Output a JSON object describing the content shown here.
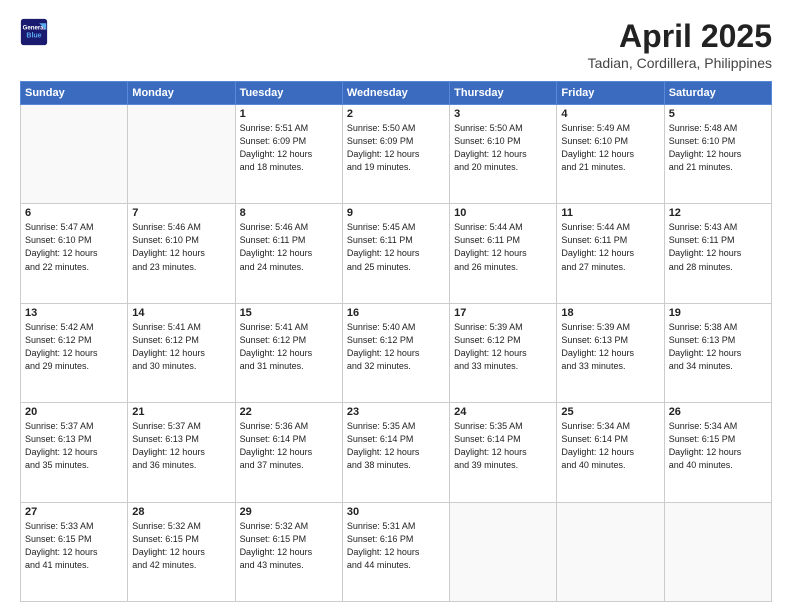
{
  "logo": {
    "line1": "General",
    "line2": "Blue"
  },
  "title": "April 2025",
  "subtitle": "Tadian, Cordillera, Philippines",
  "weekdays": [
    "Sunday",
    "Monday",
    "Tuesday",
    "Wednesday",
    "Thursday",
    "Friday",
    "Saturday"
  ],
  "weeks": [
    [
      {
        "day": "",
        "info": ""
      },
      {
        "day": "",
        "info": ""
      },
      {
        "day": "1",
        "info": "Sunrise: 5:51 AM\nSunset: 6:09 PM\nDaylight: 12 hours\nand 18 minutes."
      },
      {
        "day": "2",
        "info": "Sunrise: 5:50 AM\nSunset: 6:09 PM\nDaylight: 12 hours\nand 19 minutes."
      },
      {
        "day": "3",
        "info": "Sunrise: 5:50 AM\nSunset: 6:10 PM\nDaylight: 12 hours\nand 20 minutes."
      },
      {
        "day": "4",
        "info": "Sunrise: 5:49 AM\nSunset: 6:10 PM\nDaylight: 12 hours\nand 21 minutes."
      },
      {
        "day": "5",
        "info": "Sunrise: 5:48 AM\nSunset: 6:10 PM\nDaylight: 12 hours\nand 21 minutes."
      }
    ],
    [
      {
        "day": "6",
        "info": "Sunrise: 5:47 AM\nSunset: 6:10 PM\nDaylight: 12 hours\nand 22 minutes."
      },
      {
        "day": "7",
        "info": "Sunrise: 5:46 AM\nSunset: 6:10 PM\nDaylight: 12 hours\nand 23 minutes."
      },
      {
        "day": "8",
        "info": "Sunrise: 5:46 AM\nSunset: 6:11 PM\nDaylight: 12 hours\nand 24 minutes."
      },
      {
        "day": "9",
        "info": "Sunrise: 5:45 AM\nSunset: 6:11 PM\nDaylight: 12 hours\nand 25 minutes."
      },
      {
        "day": "10",
        "info": "Sunrise: 5:44 AM\nSunset: 6:11 PM\nDaylight: 12 hours\nand 26 minutes."
      },
      {
        "day": "11",
        "info": "Sunrise: 5:44 AM\nSunset: 6:11 PM\nDaylight: 12 hours\nand 27 minutes."
      },
      {
        "day": "12",
        "info": "Sunrise: 5:43 AM\nSunset: 6:11 PM\nDaylight: 12 hours\nand 28 minutes."
      }
    ],
    [
      {
        "day": "13",
        "info": "Sunrise: 5:42 AM\nSunset: 6:12 PM\nDaylight: 12 hours\nand 29 minutes."
      },
      {
        "day": "14",
        "info": "Sunrise: 5:41 AM\nSunset: 6:12 PM\nDaylight: 12 hours\nand 30 minutes."
      },
      {
        "day": "15",
        "info": "Sunrise: 5:41 AM\nSunset: 6:12 PM\nDaylight: 12 hours\nand 31 minutes."
      },
      {
        "day": "16",
        "info": "Sunrise: 5:40 AM\nSunset: 6:12 PM\nDaylight: 12 hours\nand 32 minutes."
      },
      {
        "day": "17",
        "info": "Sunrise: 5:39 AM\nSunset: 6:12 PM\nDaylight: 12 hours\nand 33 minutes."
      },
      {
        "day": "18",
        "info": "Sunrise: 5:39 AM\nSunset: 6:13 PM\nDaylight: 12 hours\nand 33 minutes."
      },
      {
        "day": "19",
        "info": "Sunrise: 5:38 AM\nSunset: 6:13 PM\nDaylight: 12 hours\nand 34 minutes."
      }
    ],
    [
      {
        "day": "20",
        "info": "Sunrise: 5:37 AM\nSunset: 6:13 PM\nDaylight: 12 hours\nand 35 minutes."
      },
      {
        "day": "21",
        "info": "Sunrise: 5:37 AM\nSunset: 6:13 PM\nDaylight: 12 hours\nand 36 minutes."
      },
      {
        "day": "22",
        "info": "Sunrise: 5:36 AM\nSunset: 6:14 PM\nDaylight: 12 hours\nand 37 minutes."
      },
      {
        "day": "23",
        "info": "Sunrise: 5:35 AM\nSunset: 6:14 PM\nDaylight: 12 hours\nand 38 minutes."
      },
      {
        "day": "24",
        "info": "Sunrise: 5:35 AM\nSunset: 6:14 PM\nDaylight: 12 hours\nand 39 minutes."
      },
      {
        "day": "25",
        "info": "Sunrise: 5:34 AM\nSunset: 6:14 PM\nDaylight: 12 hours\nand 40 minutes."
      },
      {
        "day": "26",
        "info": "Sunrise: 5:34 AM\nSunset: 6:15 PM\nDaylight: 12 hours\nand 40 minutes."
      }
    ],
    [
      {
        "day": "27",
        "info": "Sunrise: 5:33 AM\nSunset: 6:15 PM\nDaylight: 12 hours\nand 41 minutes."
      },
      {
        "day": "28",
        "info": "Sunrise: 5:32 AM\nSunset: 6:15 PM\nDaylight: 12 hours\nand 42 minutes."
      },
      {
        "day": "29",
        "info": "Sunrise: 5:32 AM\nSunset: 6:15 PM\nDaylight: 12 hours\nand 43 minutes."
      },
      {
        "day": "30",
        "info": "Sunrise: 5:31 AM\nSunset: 6:16 PM\nDaylight: 12 hours\nand 44 minutes."
      },
      {
        "day": "",
        "info": ""
      },
      {
        "day": "",
        "info": ""
      },
      {
        "day": "",
        "info": ""
      }
    ]
  ]
}
